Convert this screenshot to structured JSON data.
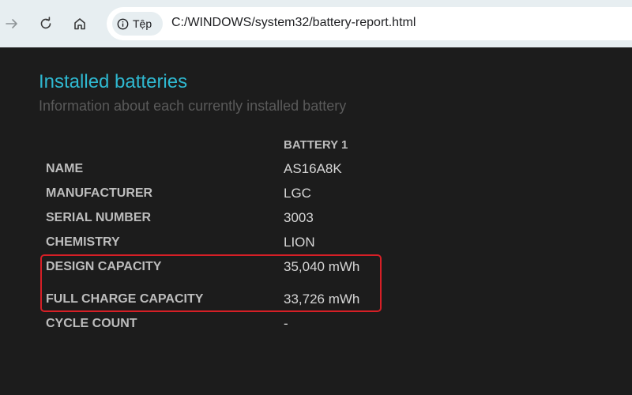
{
  "browser": {
    "site_chip_label": "Tệp",
    "url": "C:/WINDOWS/system32/battery-report.html",
    "icons": {
      "forward": "arrow-right-icon",
      "reload": "reload-icon",
      "home": "home-icon",
      "site_info": "info-icon"
    }
  },
  "report": {
    "title": "Installed batteries",
    "subtitle": "Information about each currently installed battery",
    "column_header": "BATTERY 1",
    "rows": [
      {
        "label": "NAME",
        "value": "AS16A8K"
      },
      {
        "label": "MANUFACTURER",
        "value": "LGC"
      },
      {
        "label": "SERIAL NUMBER",
        "value": "3003"
      },
      {
        "label": "CHEMISTRY",
        "value": "LION"
      },
      {
        "label": "DESIGN CAPACITY",
        "value": "35,040 mWh"
      },
      {
        "label": "FULL CHARGE CAPACITY",
        "value": "33,726 mWh"
      },
      {
        "label": "CYCLE COUNT",
        "value": "-"
      }
    ]
  },
  "colors": {
    "title": "#2fb8d0",
    "highlight": "#d61f26",
    "background": "#1c1c1c"
  }
}
